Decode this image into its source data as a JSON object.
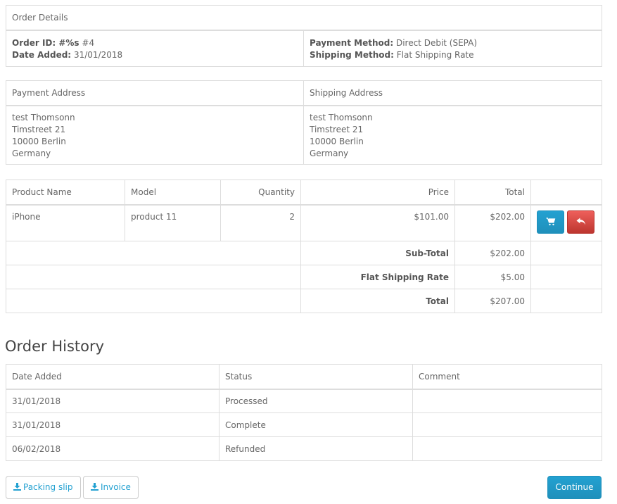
{
  "order_details": {
    "title": "Order Details",
    "order_id_label": "Order ID: #%s",
    "order_id_value": "#4",
    "date_added_label": "Date Added:",
    "date_added_value": "31/01/2018",
    "payment_method_label": "Payment Method:",
    "payment_method_value": "Direct Debit (SEPA)",
    "shipping_method_label": "Shipping Method:",
    "shipping_method_value": "Flat Shipping Rate"
  },
  "addresses": {
    "payment_title": "Payment Address",
    "shipping_title": "Shipping Address",
    "payment_lines": [
      "test Thomsonn",
      "Timstreet 21",
      "10000 Berlin",
      "Germany"
    ],
    "shipping_lines": [
      "test Thomsonn",
      "Timstreet 21",
      "10000 Berlin",
      "Germany"
    ]
  },
  "products": {
    "headers": {
      "name": "Product Name",
      "model": "Model",
      "quantity": "Quantity",
      "price": "Price",
      "total": "Total"
    },
    "items": [
      {
        "name": "iPhone",
        "model": "product 11",
        "quantity": "2",
        "price": "$101.00",
        "total": "$202.00"
      }
    ],
    "totals": [
      {
        "label": "Sub-Total",
        "value": "$202.00"
      },
      {
        "label": "Flat Shipping Rate",
        "value": "$5.00"
      },
      {
        "label": "Total",
        "value": "$207.00"
      }
    ],
    "icons": {
      "reorder": "shopping-cart-icon",
      "return": "reply-icon"
    },
    "colors": {
      "reorder_button": "#229ac8",
      "return_button": "#da4f49"
    }
  },
  "history": {
    "title": "Order History",
    "headers": {
      "date": "Date Added",
      "status": "Status",
      "comment": "Comment"
    },
    "rows": [
      {
        "date": "31/01/2018",
        "status": "Processed",
        "comment": ""
      },
      {
        "date": "31/01/2018",
        "status": "Complete",
        "comment": ""
      },
      {
        "date": "06/02/2018",
        "status": "Refunded",
        "comment": ""
      }
    ]
  },
  "actions": {
    "packing_slip": "Packing slip",
    "invoice": "Invoice",
    "continue": "Continue",
    "download_icon": "download-icon",
    "accent": "#23a1d1"
  }
}
